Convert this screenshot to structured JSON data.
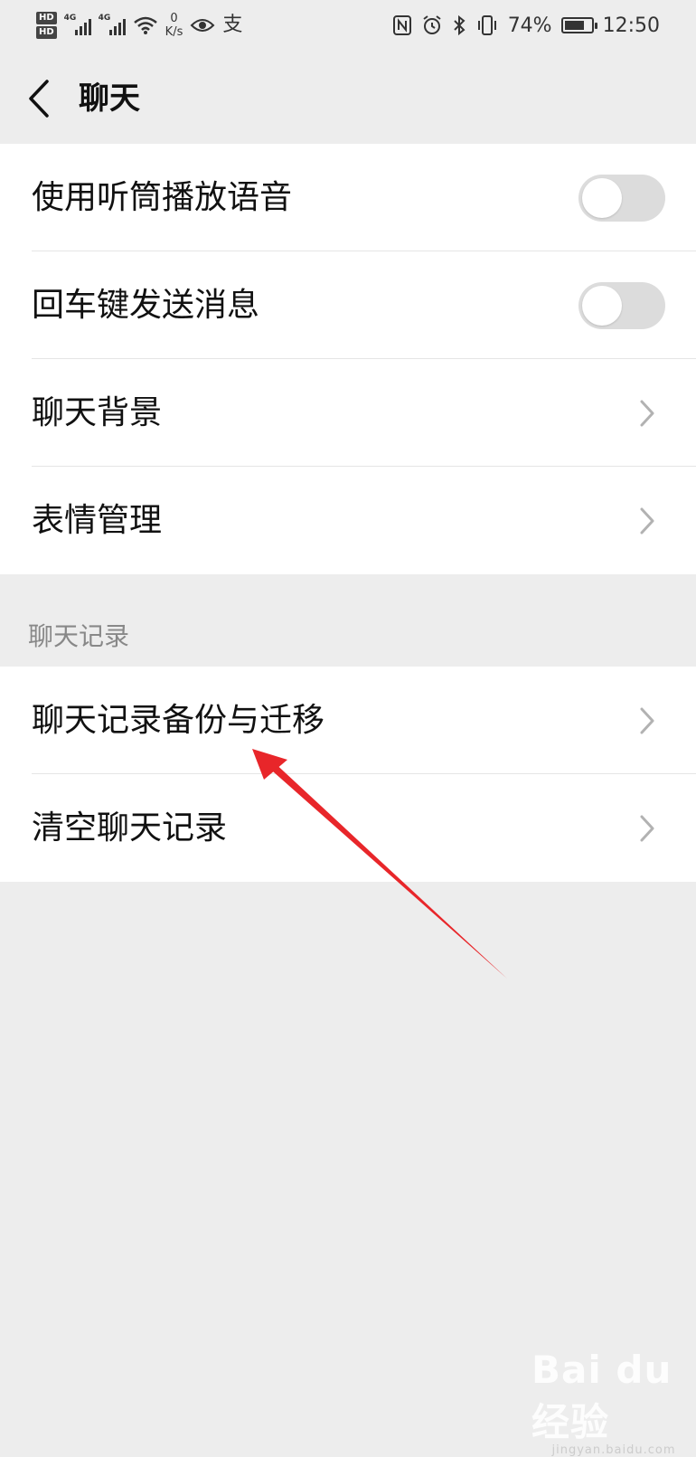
{
  "status_bar": {
    "hd1": "HD",
    "hd2": "HD",
    "net1": "4G",
    "net2": "4G",
    "speed_value": "0",
    "speed_unit": "K/s",
    "battery_percent": "74%",
    "battery_level": 0.74,
    "time": "12:50"
  },
  "header": {
    "title": "聊天"
  },
  "settings": {
    "items": [
      {
        "label": "使用听筒播放语音",
        "type": "toggle",
        "on": false
      },
      {
        "label": "回车键发送消息",
        "type": "toggle",
        "on": false
      },
      {
        "label": "聊天背景",
        "type": "link"
      },
      {
        "label": "表情管理",
        "type": "link"
      }
    ]
  },
  "chat_history": {
    "section_title": "聊天记录",
    "items": [
      {
        "label": "聊天记录备份与迁移",
        "type": "link"
      },
      {
        "label": "清空聊天记录",
        "type": "link"
      }
    ]
  },
  "watermark": {
    "text": "Bai du 经验",
    "sub": "jingyan.baidu.com"
  },
  "colors": {
    "background": "#ededed",
    "toggle_off": "#dcdcdc",
    "annotation_arrow": "#e8262a"
  }
}
